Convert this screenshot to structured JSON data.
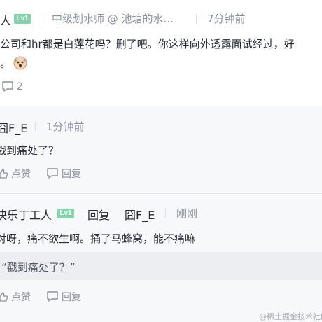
{
  "colors": {
    "accent": "#1e80ff",
    "level_badge": "#7fd6a7",
    "muted": "#8a919f",
    "text": "#252933",
    "sub_bg": "#f7f8fa"
  },
  "main_comment": {
    "user": "人",
    "level": "Lv1",
    "title": "中级划水师 @ 池塘的水...",
    "time": "7分钟前",
    "content_line1": "公司和hr都是白莲花吗？删了吧。你这样向外透露面试经过，好",
    "content_line2": "。",
    "emoji_icon": "fox-emoji",
    "reply_count": "2"
  },
  "reply1": {
    "user": "囧F_E",
    "time": "1分钟前",
    "content": "戳到痛处了？",
    "like_label": "点赞",
    "reply_label": "回复"
  },
  "reply2": {
    "user": "快乐丁工人",
    "level": "Lv1",
    "reply_word": "回复",
    "target_user": "囧F_E",
    "time": "刚刚",
    "content": "对呀，痛不欲生啊。捅了马蜂窝，能不痛嘛",
    "quote": "“戳到痛处了？”",
    "like_label": "点赞",
    "reply_label": "回复"
  },
  "watermark": "@稀土掘金技术社区"
}
